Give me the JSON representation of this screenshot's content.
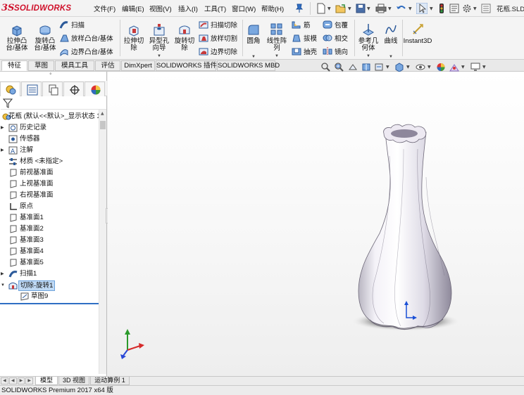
{
  "app": {
    "logo_ds": "3S",
    "logo_text": "SOLIDWORKS",
    "document_title": "花瓶.SLD"
  },
  "menu": [
    "文件(F)",
    "编辑(E)",
    "视图(V)",
    "插入(I)",
    "工具(T)",
    "窗口(W)",
    "帮助(H)"
  ],
  "commands": {
    "extrude_boss": "拉伸凸\n台/基体",
    "revolve_boss": "旋转凸\n台/基体",
    "sweep": "扫描",
    "loft_boss": "放样凸台/基体",
    "boundary_boss": "边界凸台/基体",
    "extrude_cut": "拉伸切\n除",
    "hole_wizard": "异型孔\n向导",
    "revolve_cut": "旋转切\n除",
    "swept_cut": "扫描切除",
    "lofted_cut": "放样切割",
    "boundary_cut": "边界切除",
    "fillet": "圆角",
    "linear_pattern": "线性阵\n列",
    "rib": "筋",
    "wrap": "包覆",
    "draft": "拔模",
    "intersect": "相交",
    "shell": "抽壳",
    "mirror": "镜向",
    "ref_geometry": "参考几\n何体",
    "curves": "曲线",
    "instant3d": "Instant3D"
  },
  "tabs": [
    "特征",
    "草图",
    "模具工具",
    "评估",
    "DimXpert",
    "SOLIDWORKS 插件",
    "SOLIDWORKS MBD"
  ],
  "active_tab": "特征",
  "feature_tree": {
    "root": "花瓶 (默认<<默认>_显示状态 1",
    "items": [
      {
        "label": "历史记录",
        "icon": "history-icon"
      },
      {
        "label": "传感器",
        "icon": "sensor-icon"
      },
      {
        "label": "注解",
        "icon": "annotation-icon"
      },
      {
        "label": "材质 <未指定>",
        "icon": "material-icon"
      },
      {
        "label": "前视基准面",
        "icon": "plane-icon"
      },
      {
        "label": "上视基准面",
        "icon": "plane-icon"
      },
      {
        "label": "右视基准面",
        "icon": "plane-icon"
      },
      {
        "label": "原点",
        "icon": "origin-icon"
      },
      {
        "label": "基准面1",
        "icon": "plane-icon"
      },
      {
        "label": "基准面2",
        "icon": "plane-icon"
      },
      {
        "label": "基准面3",
        "icon": "plane-icon"
      },
      {
        "label": "基准面4",
        "icon": "plane-icon"
      },
      {
        "label": "基准面5",
        "icon": "plane-icon"
      },
      {
        "label": "扫描1",
        "icon": "sweep-icon"
      },
      {
        "label": "切除-旋转1",
        "icon": "revolve-cut-icon"
      },
      {
        "label": "草图9",
        "icon": "sketch-icon"
      }
    ],
    "selected": "切除-旋转1"
  },
  "bottom_tabs": [
    "模型",
    "3D 视图",
    "运动算例 1"
  ],
  "active_bottom_tab": "模型",
  "status_bar": "SOLIDWORKS Premium 2017 x64 版",
  "colors": {
    "brand_red": "#d0112b",
    "selection": "#bfd9f4",
    "viewport_bg": "#ffffff",
    "part_color": "#e6e3ea"
  }
}
